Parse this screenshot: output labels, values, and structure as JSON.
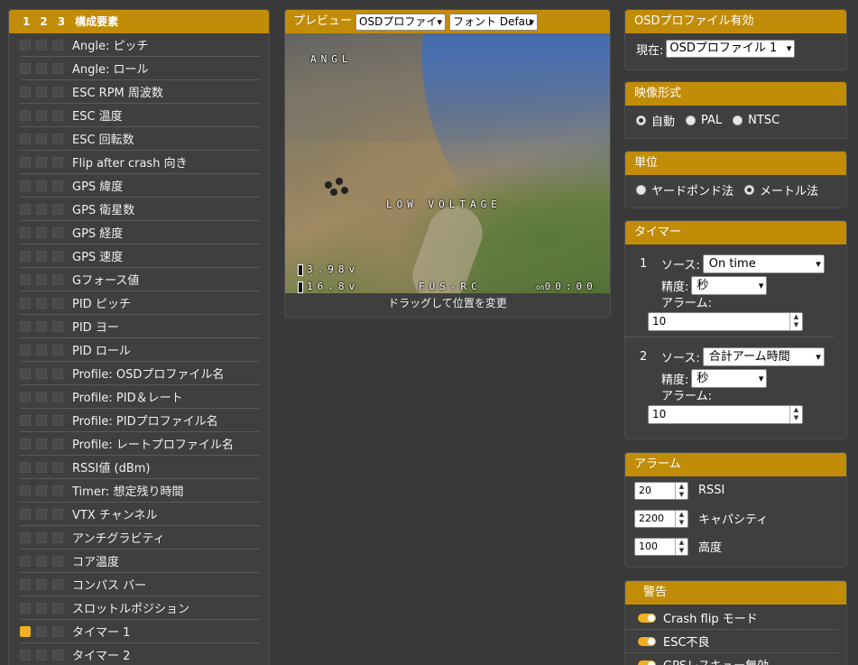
{
  "elements": {
    "header_tabs": [
      "1",
      "2",
      "3"
    ],
    "title": "構成要素",
    "items": [
      {
        "label": "Angle: ピッチ",
        "on": false
      },
      {
        "label": "Angle: ロール",
        "on": false
      },
      {
        "label": "ESC RPM 周波数",
        "on": false
      },
      {
        "label": "ESC 温度",
        "on": false
      },
      {
        "label": "ESC 回転数",
        "on": false
      },
      {
        "label": "Flip after crash 向き",
        "on": false
      },
      {
        "label": "GPS 緯度",
        "on": false
      },
      {
        "label": "GPS 衛星数",
        "on": false
      },
      {
        "label": "GPS 経度",
        "on": false
      },
      {
        "label": "GPS 速度",
        "on": false
      },
      {
        "label": "Gフォース値",
        "on": false
      },
      {
        "label": "PID ピッチ",
        "on": false
      },
      {
        "label": "PID ヨー",
        "on": false
      },
      {
        "label": "PID ロール",
        "on": false
      },
      {
        "label": "Profile: OSDプロファイル名",
        "on": false
      },
      {
        "label": "Profile: PID＆レート",
        "on": false
      },
      {
        "label": "Profile: PIDプロファイル名",
        "on": false
      },
      {
        "label": "Profile: レートプロファイル名",
        "on": false
      },
      {
        "label": "RSSI値 (dBm)",
        "on": false
      },
      {
        "label": "Timer: 想定残り時間",
        "on": false
      },
      {
        "label": "VTX チャンネル",
        "on": false
      },
      {
        "label": "アンチグラビティ",
        "on": false
      },
      {
        "label": "コア温度",
        "on": false
      },
      {
        "label": "コンパス バー",
        "on": false
      },
      {
        "label": "スロットルポジション",
        "on": false
      },
      {
        "label": "タイマー 1",
        "on": true
      },
      {
        "label": "タイマー 2",
        "on": false
      }
    ]
  },
  "preview": {
    "title": "プレビュー",
    "profile_select": "OSDプロファイ",
    "font_select": "フォント Defau",
    "osd": {
      "angl": "ANGL",
      "low_voltage": "LOW VOLTAGE",
      "cell_voltage": "3.98v",
      "pack_voltage": "16.8v",
      "craft_name": "FUS-RC",
      "timer": "00:00",
      "timer_symbol": "on"
    },
    "hint": "ドラッグして位置を変更"
  },
  "osd_profile": {
    "title": "OSDプロファイル有効",
    "current_label": "現在:",
    "current_value": "OSDプロファイル 1"
  },
  "video_format": {
    "title": "映像形式",
    "options": [
      "自動",
      "PAL",
      "NTSC"
    ],
    "selected": "自動"
  },
  "units": {
    "title": "単位",
    "options": [
      "ヤードポンド法",
      "メートル法"
    ],
    "selected": "メートル法"
  },
  "timers": {
    "title": "タイマー",
    "source_label": "ソース:",
    "precision_label": "精度:",
    "alarm_label": "アラーム:",
    "items": [
      {
        "index": "1",
        "source": "On time",
        "precision": "秒",
        "alarm": "10"
      },
      {
        "index": "2",
        "source": "合計アーム時間",
        "precision": "秒",
        "alarm": "10"
      }
    ]
  },
  "alarms": {
    "title": "アラーム",
    "items": [
      {
        "value": "20",
        "label": "RSSI"
      },
      {
        "value": "2200",
        "label": "キャパシティ"
      },
      {
        "value": "100",
        "label": "高度"
      }
    ]
  },
  "warnings": {
    "title": "警告",
    "items": [
      {
        "label": "Crash flip モード",
        "on": true
      },
      {
        "label": "ESC不良",
        "on": true
      },
      {
        "label": "GPSレスキュー無効",
        "on": true
      }
    ]
  },
  "colors": {
    "header": "#c18c08",
    "background": "#393939",
    "toggle_on": "#f0b020"
  }
}
